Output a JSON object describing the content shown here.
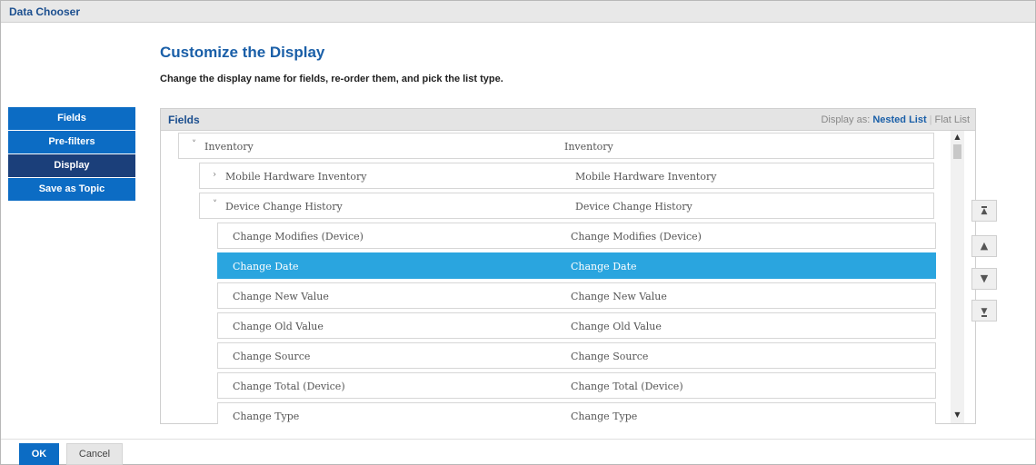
{
  "window": {
    "title": "Data Chooser"
  },
  "page": {
    "heading": "Customize the Display",
    "subheading": "Change the display name for fields, re-order them, and pick the list type."
  },
  "sidenav": {
    "items": [
      {
        "label": "Fields",
        "active": false
      },
      {
        "label": "Pre-filters",
        "active": false
      },
      {
        "label": "Display",
        "active": true
      },
      {
        "label": "Save as Topic",
        "active": false
      }
    ]
  },
  "panel": {
    "title": "Fields",
    "display_as_label": "Display as:",
    "option_nested": "Nested List",
    "option_separator": "|",
    "option_flat": "Flat List",
    "selected_option": "Nested List"
  },
  "tree": {
    "rows": [
      {
        "name": "Inventory",
        "display": "Inventory",
        "toggle": "˅",
        "selected": false
      },
      {
        "name": "Mobile Hardware Inventory",
        "display": "Mobile Hardware Inventory",
        "toggle": "›",
        "selected": false
      },
      {
        "name": "Device Change History",
        "display": "Device Change History",
        "toggle": "˅",
        "selected": false
      },
      {
        "name": "Change Modifies (Device)",
        "display": "Change Modifies (Device)",
        "toggle": "",
        "selected": false
      },
      {
        "name": "Change Date",
        "display": "Change Date",
        "toggle": "",
        "selected": true
      },
      {
        "name": "Change New Value",
        "display": "Change New Value",
        "toggle": "",
        "selected": false
      },
      {
        "name": "Change Old Value",
        "display": "Change Old Value",
        "toggle": "",
        "selected": false
      },
      {
        "name": "Change Source",
        "display": "Change Source",
        "toggle": "",
        "selected": false
      },
      {
        "name": "Change Total (Device)",
        "display": "Change Total (Device)",
        "toggle": "",
        "selected": false
      },
      {
        "name": "Change Type",
        "display": "Change Type",
        "toggle": "",
        "selected": false
      }
    ]
  },
  "move_buttons": {
    "top_icon": "move-to-top-icon",
    "up_icon": "move-up-icon",
    "down_icon": "move-down-icon",
    "bottom_icon": "move-to-bottom-icon"
  },
  "footer": {
    "ok_label": "OK",
    "cancel_label": "Cancel"
  },
  "colors": {
    "accent": "#0c6cc4",
    "nav_active": "#1b3f7a",
    "selection": "#2aa5df",
    "heading": "#1a5fa8"
  }
}
